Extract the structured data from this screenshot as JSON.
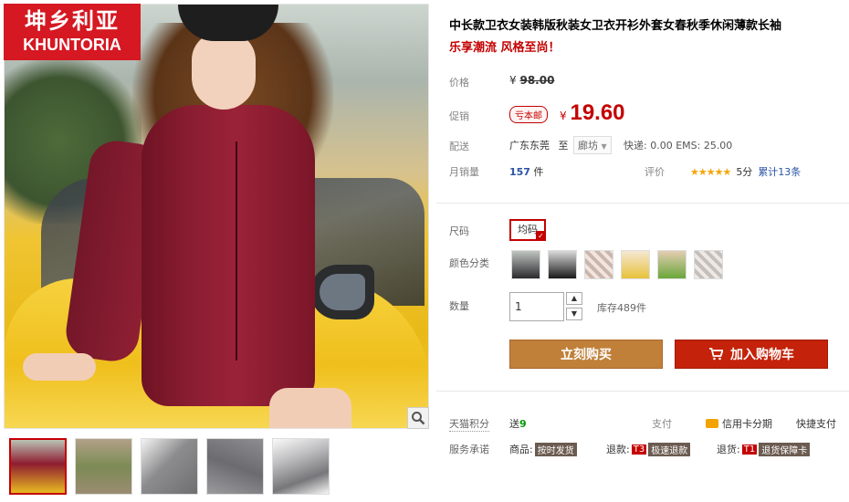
{
  "brand": {
    "name_cn": "坤乡利亚",
    "name_en": "KHUNTORIA"
  },
  "product": {
    "title": "中长款卫衣女装韩版秋装女卫衣开衫外套女春秋季休闲薄款长袖",
    "subtitle": "乐享潮流 风格至尚！"
  },
  "price": {
    "label": "价格",
    "currency": "¥",
    "original": "98.00"
  },
  "promo": {
    "label": "促销",
    "tag": "亏本邮",
    "currency": "¥",
    "price": "19.60"
  },
  "delivery": {
    "label": "配送",
    "from": "广东东莞",
    "to_word": "至",
    "to": "廊坊",
    "fee": "快递: 0.00 EMS: 25.00"
  },
  "sales": {
    "label": "月销量",
    "count": "157",
    "unit": "件"
  },
  "rating": {
    "label": "评价",
    "stars": "★★★★★",
    "score": "5分",
    "total": "累计13条"
  },
  "size": {
    "label": "尺码",
    "selected": "均码"
  },
  "color": {
    "label": "颜色分类"
  },
  "quantity": {
    "label": "数量",
    "value": "1",
    "stock": "库存489件"
  },
  "actions": {
    "buy_now": "立刻购买",
    "add_cart": "加入购物车"
  },
  "points": {
    "label": "天猫积分",
    "prefix": "送",
    "amount": "9"
  },
  "payment": {
    "label": "支付",
    "credit": "信用卡分期",
    "quick": "快捷支付"
  },
  "service": {
    "label": "服务承诺",
    "goods_label": "商品:",
    "goods_tag": "按时发货",
    "refund_label": "退款:",
    "refund_code": "T3",
    "refund_tag": "极速退款",
    "return_label": "退货:",
    "return_code": "T1",
    "return_tag": "退货保障卡"
  },
  "colors": {
    "accent": "#c40000",
    "buy_now": "#c0803a",
    "add_cart": "#c4220a",
    "link": "#2953a6"
  }
}
